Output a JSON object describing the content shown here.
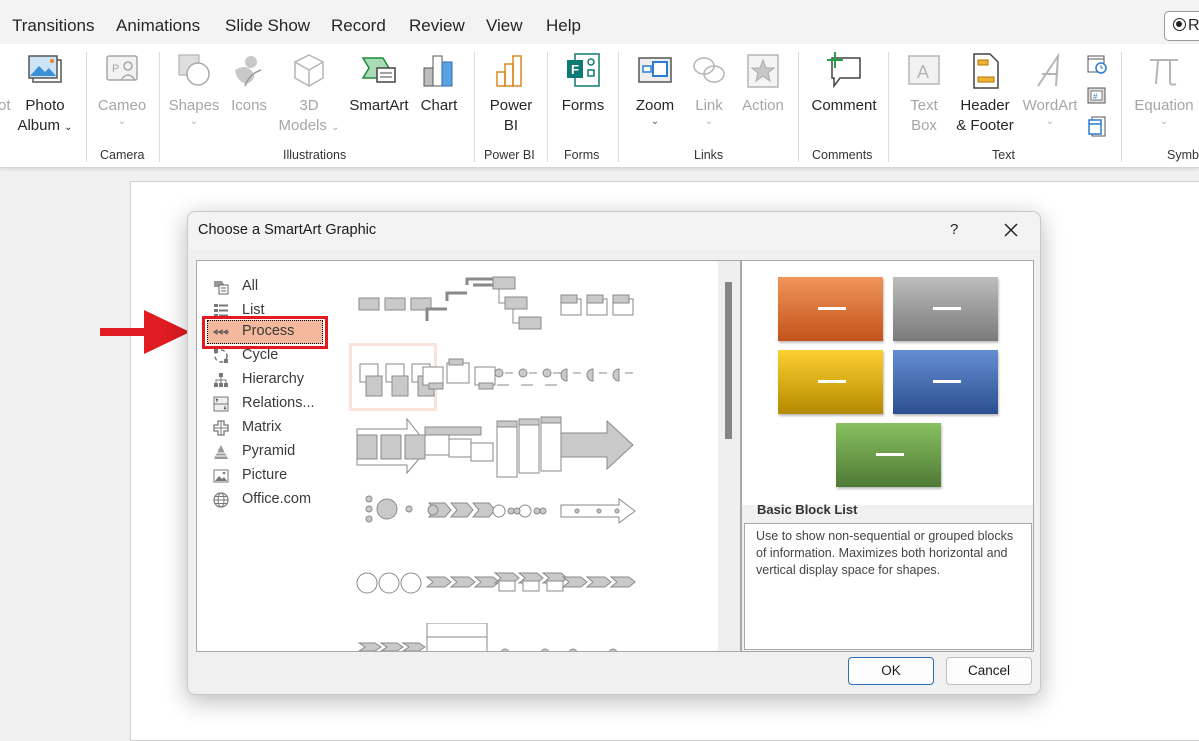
{
  "tabs": [
    "Transitions",
    "Animations",
    "Slide Show",
    "Record",
    "Review",
    "View",
    "Help"
  ],
  "record_button": {
    "label": "R"
  },
  "ribbon": {
    "partial_left_label": "ot",
    "buttons": [
      {
        "id": "photo-album",
        "line1": "Photo",
        "line2": "Album",
        "dropdown": true,
        "enabled": true
      },
      {
        "id": "cameo",
        "line1": "Cameo",
        "dropdown": true,
        "enabled": false
      },
      {
        "id": "shapes",
        "line1": "Shapes",
        "dropdown": true,
        "enabled": false
      },
      {
        "id": "icons",
        "line1": "Icons",
        "enabled": false
      },
      {
        "id": "3d-models",
        "line1": "3D",
        "line2": "Models",
        "dropdown": true,
        "enabled": false
      },
      {
        "id": "smartart",
        "line1": "SmartArt",
        "enabled": true
      },
      {
        "id": "chart",
        "line1": "Chart",
        "enabled": true
      },
      {
        "id": "power-bi",
        "line1": "Power",
        "line2": "BI",
        "enabled": true
      },
      {
        "id": "forms",
        "line1": "Forms",
        "enabled": true
      },
      {
        "id": "zoom",
        "line1": "Zoom",
        "dropdown": true,
        "enabled": true
      },
      {
        "id": "link",
        "line1": "Link",
        "dropdown": true,
        "enabled": false
      },
      {
        "id": "action",
        "line1": "Action",
        "enabled": false
      },
      {
        "id": "comment",
        "line1": "Comment",
        "enabled": true
      },
      {
        "id": "text-box",
        "line1": "Text",
        "line2": "Box",
        "enabled": false
      },
      {
        "id": "header-footer",
        "line1": "Header",
        "line2": "& Footer",
        "enabled": true
      },
      {
        "id": "wordart",
        "line1": "WordArt",
        "dropdown": true,
        "enabled": false
      },
      {
        "id": "equation",
        "line1": "Equation",
        "dropdown": true,
        "enabled": false
      }
    ],
    "groups": [
      "Camera",
      "Illustrations",
      "Power BI",
      "Forms",
      "Links",
      "Comments",
      "Text",
      "Symb"
    ],
    "small_icons": [
      "date-time-icon",
      "slide-number-icon",
      "object-icon"
    ]
  },
  "dialog": {
    "title": "Choose a SmartArt Graphic",
    "help": "?",
    "categories": [
      {
        "label": "All",
        "icon": "all-icon"
      },
      {
        "label": "List",
        "icon": "list-icon"
      },
      {
        "label": "Process",
        "icon": "process-icon",
        "selected": true
      },
      {
        "label": "Cycle",
        "icon": "cycle-icon"
      },
      {
        "label": "Hierarchy",
        "icon": "hierarchy-icon"
      },
      {
        "label": "Relations...",
        "icon": "relationship-icon"
      },
      {
        "label": "Matrix",
        "icon": "matrix-icon"
      },
      {
        "label": "Pyramid",
        "icon": "pyramid-icon"
      },
      {
        "label": "Picture",
        "icon": "picture-icon"
      },
      {
        "label": "Office.com",
        "icon": "globe-icon"
      }
    ],
    "gallery": [
      "basic-process",
      "step-up-process",
      "step-down-process",
      "accent-process",
      "alternating-flow",
      "continuous-block-process",
      "basic-timeline",
      "circle-accent-timeline",
      "process-arrows",
      "vertical-process-list",
      "staggered-process",
      "upward-arrow",
      "circular-bending",
      "repeating-bending",
      "circle-process",
      "detailed-process",
      "basic-chevron",
      "closed-chevron",
      "chevron-accent",
      "continuous-arrow",
      "chevron-list",
      "vertical-chevron-list",
      "partial-1",
      "partial-2"
    ],
    "hovered_gallery_index": 4,
    "preview": {
      "name": "Basic Block List",
      "description": "Use to show non-sequential or grouped blocks of information. Maximizes both horizontal and vertical display space for shapes.",
      "block_colors": [
        [
          "#f0955a",
          "#c3531a"
        ],
        [
          "#bdbdbd",
          "#7a7a7a"
        ],
        [
          "#fdd030",
          "#b38a00"
        ],
        [
          "#658ed3",
          "#2c4f8f"
        ],
        [
          "#88c060",
          "#4f7a35"
        ]
      ]
    },
    "ok_label": "OK",
    "cancel_label": "Cancel"
  },
  "annotation": {
    "arrow_color": "#e01b22",
    "highlight_color": "#e01b22"
  }
}
